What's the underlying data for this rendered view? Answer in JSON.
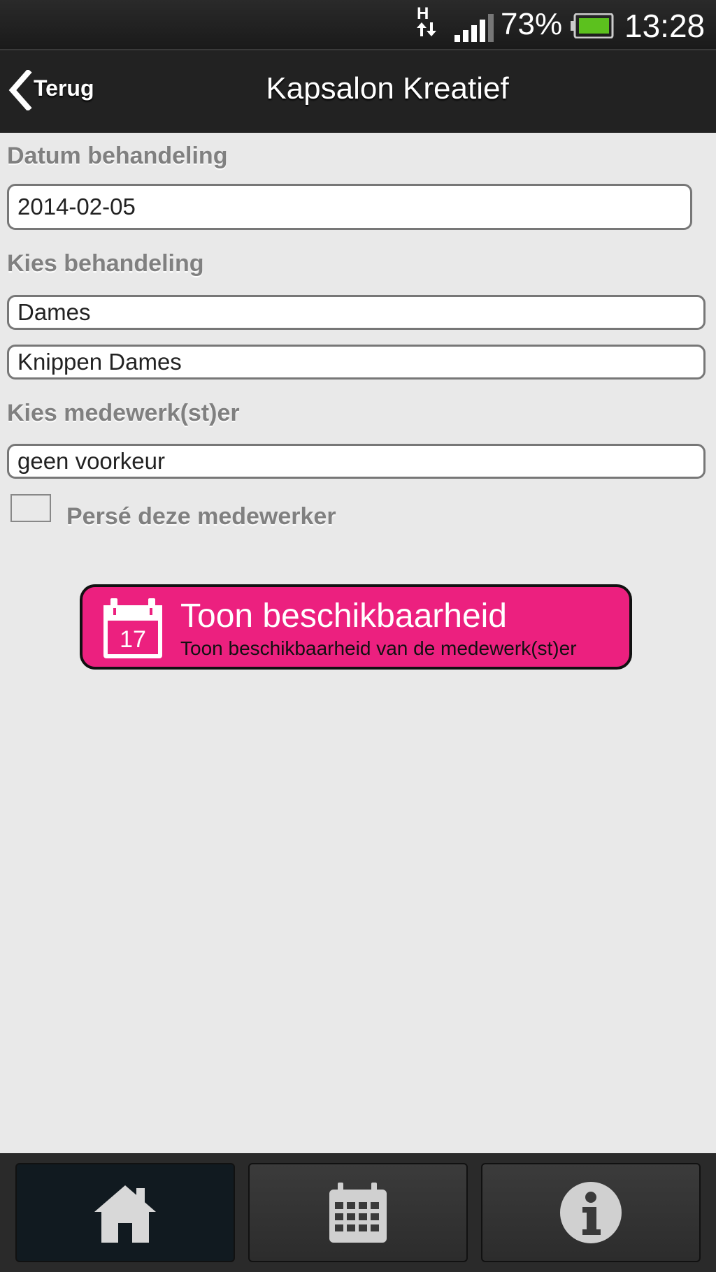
{
  "status_bar": {
    "network_indicator": "H",
    "battery_percent": "73%",
    "time": "13:28",
    "battery_color": "#5cc11e"
  },
  "header": {
    "back_label": "Terug",
    "title": "Kapsalon Kreatief"
  },
  "form": {
    "date_label": "Datum behandeling",
    "date_value": "2014-02-05",
    "treatment_label": "Kies behandeling",
    "treatment_category": "Dames",
    "treatment": "Knippen Dames",
    "employee_label": "Kies medewerk(st)er",
    "employee": "geen voorkeur",
    "checkbox_label": "Persé deze medewerker",
    "checkbox_checked": false
  },
  "availability_button": {
    "title": "Toon beschikbaarheid",
    "subtitle": "Toon beschikbaarheid van de medewerk(st)er",
    "calendar_day": "17",
    "color": "#ec207f"
  },
  "tabbar": {
    "tabs": [
      {
        "icon": "home-icon",
        "active": true
      },
      {
        "icon": "calendar-icon",
        "active": false
      },
      {
        "icon": "info-icon",
        "active": false
      }
    ]
  }
}
